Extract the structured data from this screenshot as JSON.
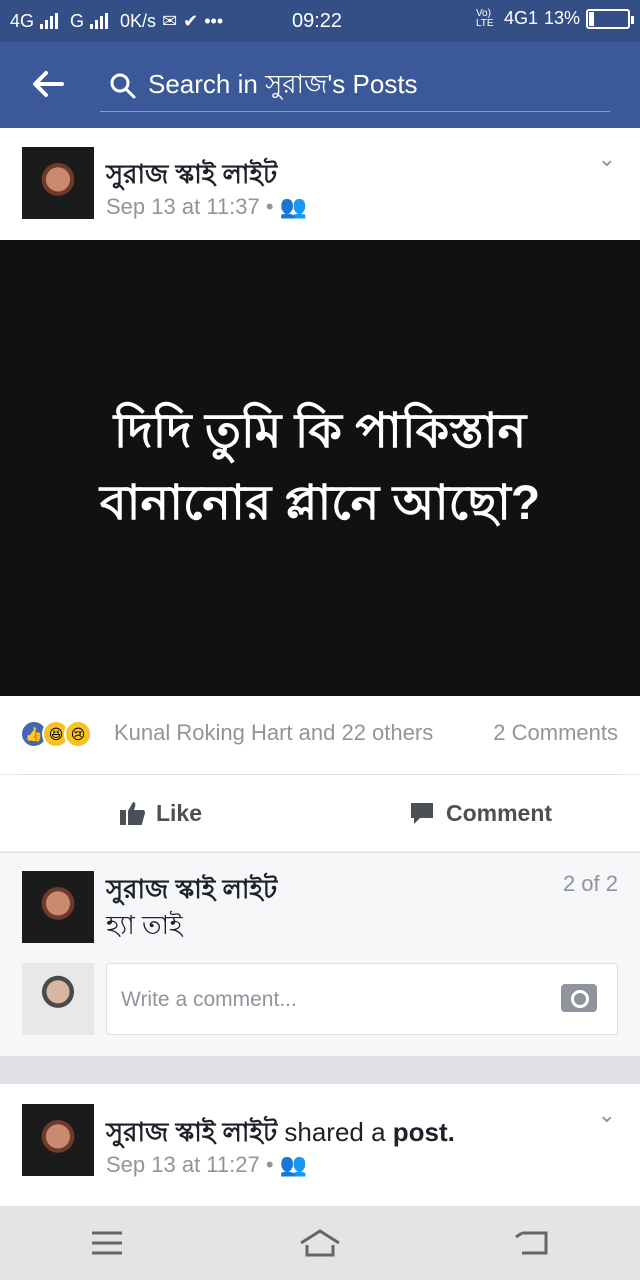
{
  "status": {
    "signal1": "4G",
    "signal2": "G",
    "speed": "0K/s",
    "time": "09:22",
    "lte": "Vo) LTE",
    "net": "4G1",
    "battery": "13%",
    "battery_level": 0.13
  },
  "appbar": {
    "search_placeholder": "Search in সুরাজ's Posts"
  },
  "post": {
    "author": "সুরাজ স্কাই লাইট",
    "timestamp": "Sep 13 at 11:37 •",
    "caption": "দিদি তুমি কি পাকিস্তান বানানোর প্লানে আছো?",
    "reactions_text": "Kunal Roking Hart and 22 others",
    "comments_count": "2 Comments",
    "like_label": "Like",
    "comment_label": "Comment"
  },
  "comment": {
    "author": "সুরাজ স্কাই লাইট",
    "text": "হ্যা তাই",
    "pager": "2 of 2",
    "placeholder": "Write a comment..."
  },
  "post2": {
    "author": "সুরাজ স্কাই লাইট",
    "shared": "shared a",
    "post": "post.",
    "timestamp": "Sep 13 at 11:27 •"
  },
  "colors": {
    "brand": "#3b5998",
    "status": "#344f86"
  }
}
